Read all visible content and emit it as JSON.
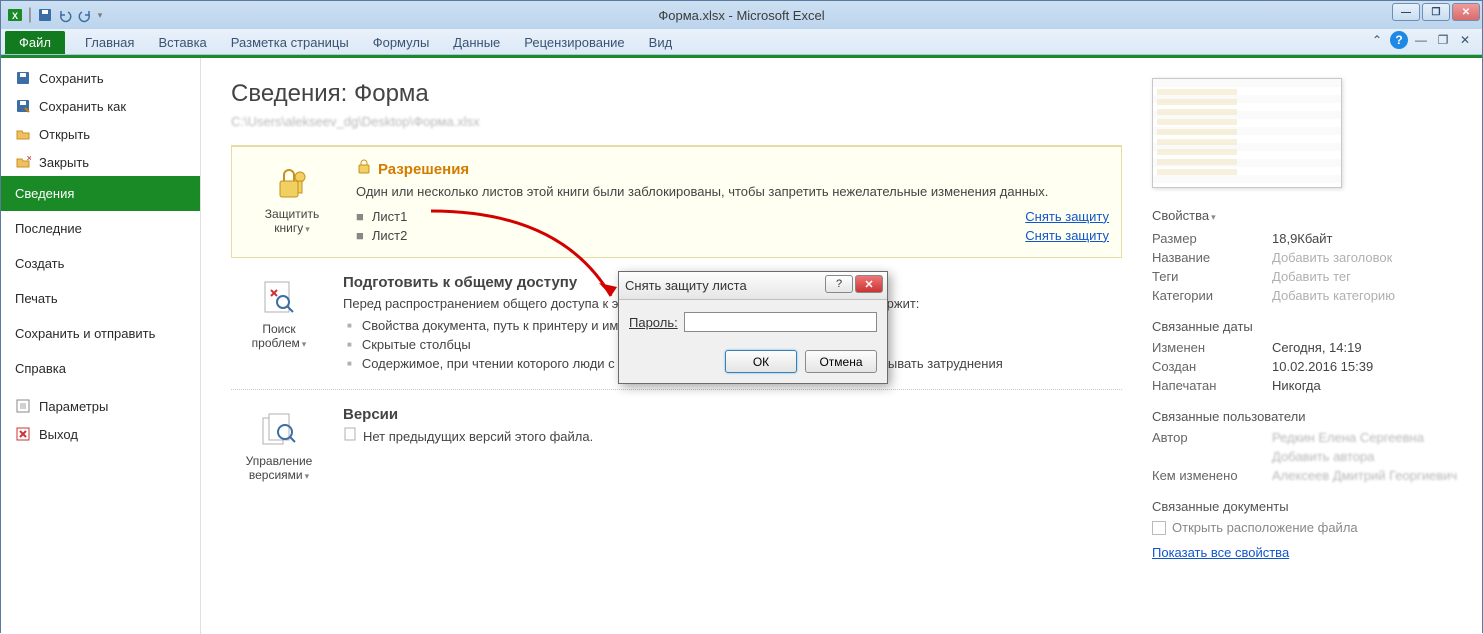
{
  "titlebar": {
    "title": "Форма.xlsx - Microsoft Excel"
  },
  "ribbon": {
    "file": "Файл",
    "tabs": [
      "Главная",
      "Вставка",
      "Разметка страницы",
      "Формулы",
      "Данные",
      "Рецензирование",
      "Вид"
    ]
  },
  "backstage_nav": {
    "save": "Сохранить",
    "save_as": "Сохранить как",
    "open": "Открыть",
    "close": "Закрыть",
    "info": "Сведения",
    "recent": "Последние",
    "new": "Создать",
    "print": "Печать",
    "save_send": "Сохранить и отправить",
    "help": "Справка",
    "options": "Параметры",
    "exit": "Выход"
  },
  "info": {
    "title": "Сведения: Форма",
    "path": "C:\\Users\\alekseev_dg\\Desktop\\Форма.xlsx",
    "permissions": {
      "button": "Защитить книгу",
      "heading": "Разрешения",
      "desc": "Один или несколько листов этой книги были заблокированы, чтобы запретить нежелательные изменения данных.",
      "sheets": [
        {
          "name": "Лист1",
          "action": "Снять защиту"
        },
        {
          "name": "Лист2",
          "action": "Снять защиту"
        }
      ]
    },
    "prepare": {
      "button": "Поиск проблем",
      "heading": "Подготовить к общему доступу",
      "desc": "Перед распространением общего доступа к этому файлу необходимо учесть, что он содержит:",
      "items": [
        "Свойства документа, путь к принтеру и имя автора",
        "Скрытые столбцы",
        "Содержимое, при чтении которого люди с ограниченными возможностями будут испытывать затруднения"
      ]
    },
    "versions": {
      "button": "Управление версиями",
      "heading": "Версии",
      "desc": "Нет предыдущих версий этого файла."
    }
  },
  "properties": {
    "heading": "Свойства",
    "size": {
      "k": "Размер",
      "v": "18,9Кбайт"
    },
    "title": {
      "k": "Название",
      "v": "Добавить заголовок"
    },
    "tags": {
      "k": "Теги",
      "v": "Добавить тег"
    },
    "categories": {
      "k": "Категории",
      "v": "Добавить категорию"
    },
    "dates_heading": "Связанные даты",
    "modified": {
      "k": "Изменен",
      "v": "Сегодня, 14:19"
    },
    "created": {
      "k": "Создан",
      "v": "10.02.2016 15:39"
    },
    "printed": {
      "k": "Напечатан",
      "v": "Никогда"
    },
    "users_heading": "Связанные пользователи",
    "author": {
      "k": "Автор",
      "v": "Редкин Елена Сергеевна"
    },
    "add_author": "Добавить автора",
    "last_mod_by": {
      "k": "Кем изменено",
      "v": "Алексеев Дмитрий Георгиевич"
    },
    "docs_heading": "Связанные документы",
    "open_location": "Открыть расположение файла",
    "show_all": "Показать все свойства"
  },
  "dialog": {
    "title": "Снять защиту листа",
    "password_label": "Пароль:",
    "ok": "ОК",
    "cancel": "Отмена"
  }
}
